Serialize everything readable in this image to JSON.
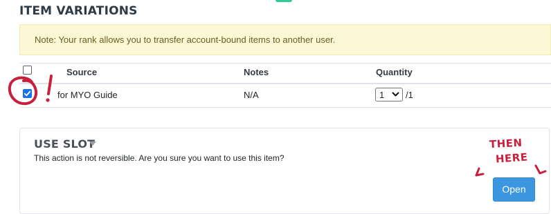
{
  "section": {
    "title": "ITEM VARIATIONS"
  },
  "note": {
    "text": "Note: Your rank allows you to transfer account-bound items to another user."
  },
  "table": {
    "headers": {
      "source": "Source",
      "notes": "Notes",
      "quantity": "Quantity"
    },
    "rows": [
      {
        "checked": true,
        "source": "for MYO Guide",
        "notes": "N/A",
        "quantity_selected": "1",
        "quantity_suffix": "/1"
      }
    ]
  },
  "use_slot": {
    "title": "USE SLOT",
    "message": "This action is not reversible. Are you sure you want to use this item?",
    "open_label": "Open"
  },
  "annotations": {
    "exclamation": "!",
    "then": "THEN",
    "here": "HERE"
  },
  "colors": {
    "note_bg": "#fcf8d6",
    "primary_button": "#3d96e0",
    "annotation_red": "#c8203c",
    "checkbox_blue": "#1a73e8"
  }
}
